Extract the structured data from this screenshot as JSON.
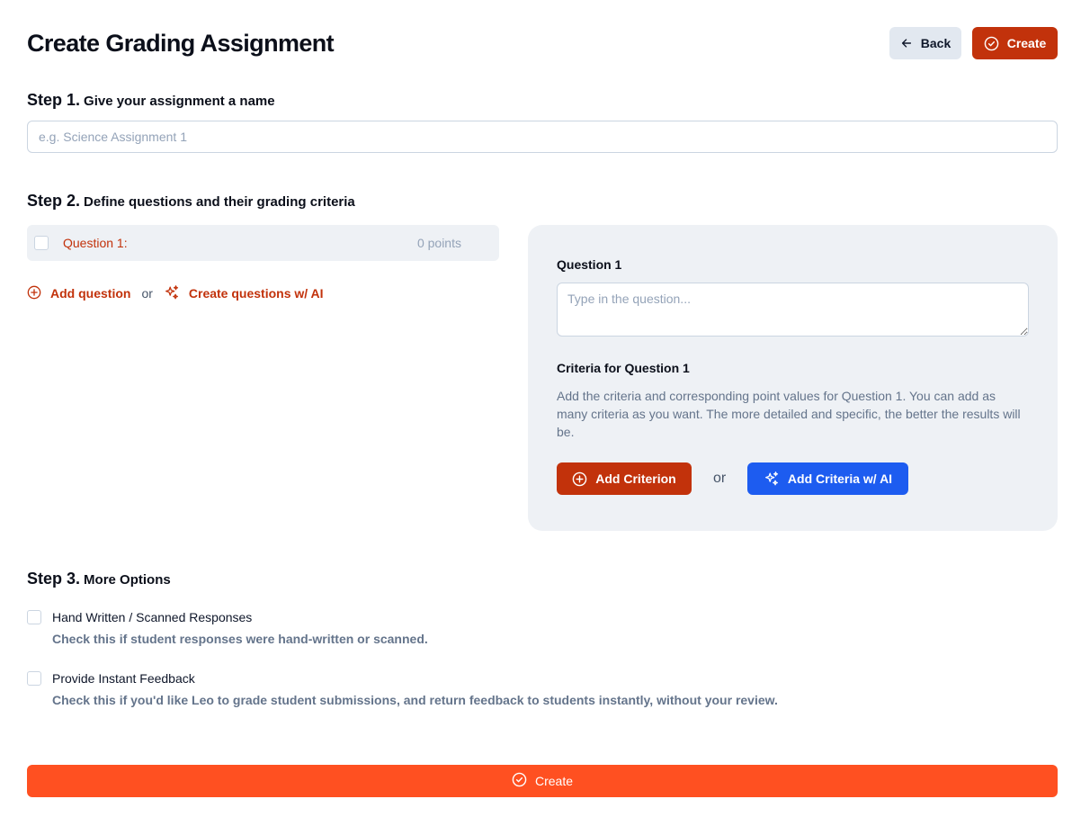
{
  "header": {
    "title": "Create Grading Assignment",
    "back_label": "Back",
    "create_label": "Create"
  },
  "step1": {
    "number": "Step 1.",
    "title": "Give your assignment a name",
    "input_placeholder": "e.g. Science Assignment 1",
    "input_value": ""
  },
  "step2": {
    "number": "Step 2.",
    "title": "Define questions and their grading criteria",
    "questions": [
      {
        "label": "Question 1:",
        "points": "0 points"
      }
    ],
    "add_question_label": "Add question",
    "or_label": "or",
    "ai_questions_label": "Create questions w/ AI",
    "editor": {
      "question_title": "Question 1",
      "question_placeholder": "Type in the question...",
      "criteria_title": "Criteria for Question 1",
      "criteria_description": "Add the criteria and corresponding point values for Question 1. You can add as many criteria as you want. The more detailed and specific, the better the results will be.",
      "add_criterion_label": "Add Criterion",
      "or_label": "or",
      "ai_criteria_label": "Add Criteria w/ AI"
    }
  },
  "step3": {
    "number": "Step 3.",
    "title": "More Options",
    "options": [
      {
        "label": "Hand Written / Scanned Responses",
        "help": "Check this if student responses were hand-written or scanned."
      },
      {
        "label": "Provide Instant Feedback",
        "help": "Check this if you'd like Leo to grade student submissions, and return feedback to students instantly, without your review."
      }
    ]
  },
  "footer": {
    "create_label": "Create"
  },
  "colors": {
    "primary": "#c2320b",
    "footer_button": "#ff5021",
    "ai_button": "#1d5cf0",
    "panel_bg": "#eef1f5"
  },
  "icons": {
    "back": "arrow-left-icon",
    "create": "check-circle-icon",
    "add": "plus-circle-icon",
    "ai": "sparkles-icon"
  }
}
